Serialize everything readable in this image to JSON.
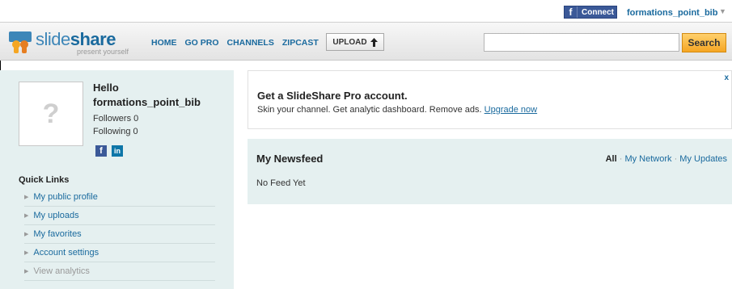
{
  "topbar": {
    "fb_connect_label": "Connect",
    "user_name": "formations_point_bib",
    "caret": "▼"
  },
  "header": {
    "logo_text_a": "slide",
    "logo_text_b": "share",
    "logo_tagline": "present yourself",
    "nav": [
      "HOME",
      "GO PRO",
      "CHANNELS",
      "ZIPCAST"
    ],
    "upload_label": "UPLOAD",
    "search_value": "",
    "search_button": "Search"
  },
  "profile": {
    "avatar_glyph": "?",
    "hello": "Hello",
    "username": "formations_point_bib",
    "followers": "Followers 0",
    "following": "Following 0"
  },
  "quick_links": {
    "title": "Quick Links",
    "items": [
      {
        "label": "My public profile",
        "enabled": true
      },
      {
        "label": "My uploads",
        "enabled": true
      },
      {
        "label": "My favorites",
        "enabled": true
      },
      {
        "label": "Account settings",
        "enabled": true
      },
      {
        "label": "View analytics",
        "enabled": false
      }
    ]
  },
  "promo": {
    "title": "Get a SlideShare Pro account.",
    "desc": "Skin your channel. Get analytic dashboard. Remove ads.",
    "link": "Upgrade now",
    "close": "x"
  },
  "newsfeed": {
    "title": "My Newsfeed",
    "filter_all": "All",
    "filter_network": "My Network",
    "filter_updates": "My Updates",
    "empty": "No Feed Yet"
  },
  "colors": {
    "brand_blue": "#1a6a9e",
    "facebook": "#3b5998",
    "search_orange": "#f5a623",
    "sidebar_bg": "#e5f0f0"
  }
}
